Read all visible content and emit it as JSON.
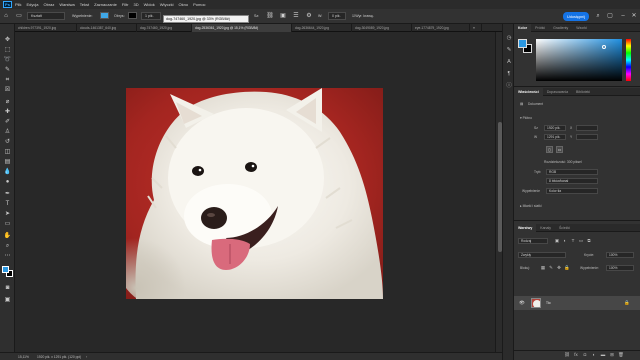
{
  "menubar": {
    "app_logo": "Ps",
    "items": [
      "Plik",
      "Edycja",
      "Obraz",
      "Warstwa",
      "Tekst",
      "Zaznaczanie",
      "Filtr",
      "3D",
      "Widok",
      "Wtyczki",
      "Okno",
      "Pomoc"
    ]
  },
  "options": {
    "tool_preset": "Kształt",
    "fill_label": "Wypełnienie:",
    "stroke_label": "Obrys:",
    "stroke_width": "1 pik.",
    "width_label": "Sz:",
    "height_label": "W:",
    "radius_value": "0 pik.",
    "align_edges": "Wyr. krawę.",
    "share_label": "Udostępnij",
    "fill_color": "#3fa7e6",
    "stroke_color": "#000000"
  },
  "tooltip": "dog-747460_1920.jpg @ 33% (RGB/8#)",
  "tabs": [
    {
      "label": "children-977391_1920.jpg"
    },
    {
      "label": "clouds-1461387_640.jpg"
    },
    {
      "label": "dog-747460_1920.jpg"
    },
    {
      "label": "dog-2536361_1920.jpg @ 15,1% (RGB/8#)"
    },
    {
      "label": "dog-2636644_1920.jpg"
    },
    {
      "label": "dog-3049089_1920.jpg"
    },
    {
      "label": "eye-1774879_1920.jpg"
    }
  ],
  "status": {
    "zoom": "15,11%",
    "info": "1920 pik. x 1291 pik. (120 ppi)"
  },
  "color_panel": {
    "tabs": [
      "Kolor",
      "Próbki",
      "Gradienty",
      "Wzorki"
    ],
    "fg": "#2b97e0",
    "bg": "#000000"
  },
  "properties_panel": {
    "tabs": [
      "Właściwości",
      "Dopasowania",
      "Biblioteki"
    ],
    "doc_label": "Dokument",
    "section_canvas": "Płótno",
    "width_label": "Sz",
    "width_value": "1920 pik.",
    "height_label": "W",
    "height_value": "1291 pik.",
    "x_label": "X",
    "y_label": "Y",
    "resolution": "Rozdzielczość: 300 piksel",
    "mode_label": "Tryb",
    "mode_value": "RGB",
    "depth_value": "8 bitów/kanał",
    "fill_label": "Wypełnienie",
    "fill_value": "Kolor tła",
    "section_rulers": "Miarki i siatki"
  },
  "layers_panel": {
    "tabs": [
      "Warstwy",
      "Kanały",
      "Ścieżki"
    ],
    "kind_label": "Rodzaj",
    "blend_mode": "Zwykły",
    "opacity_label": "Krycie:",
    "opacity_value": "100%",
    "lock_label": "Blokuj:",
    "fill_label": "Wypełnienie:",
    "fill_value": "100%",
    "layer_name": "Tło"
  }
}
